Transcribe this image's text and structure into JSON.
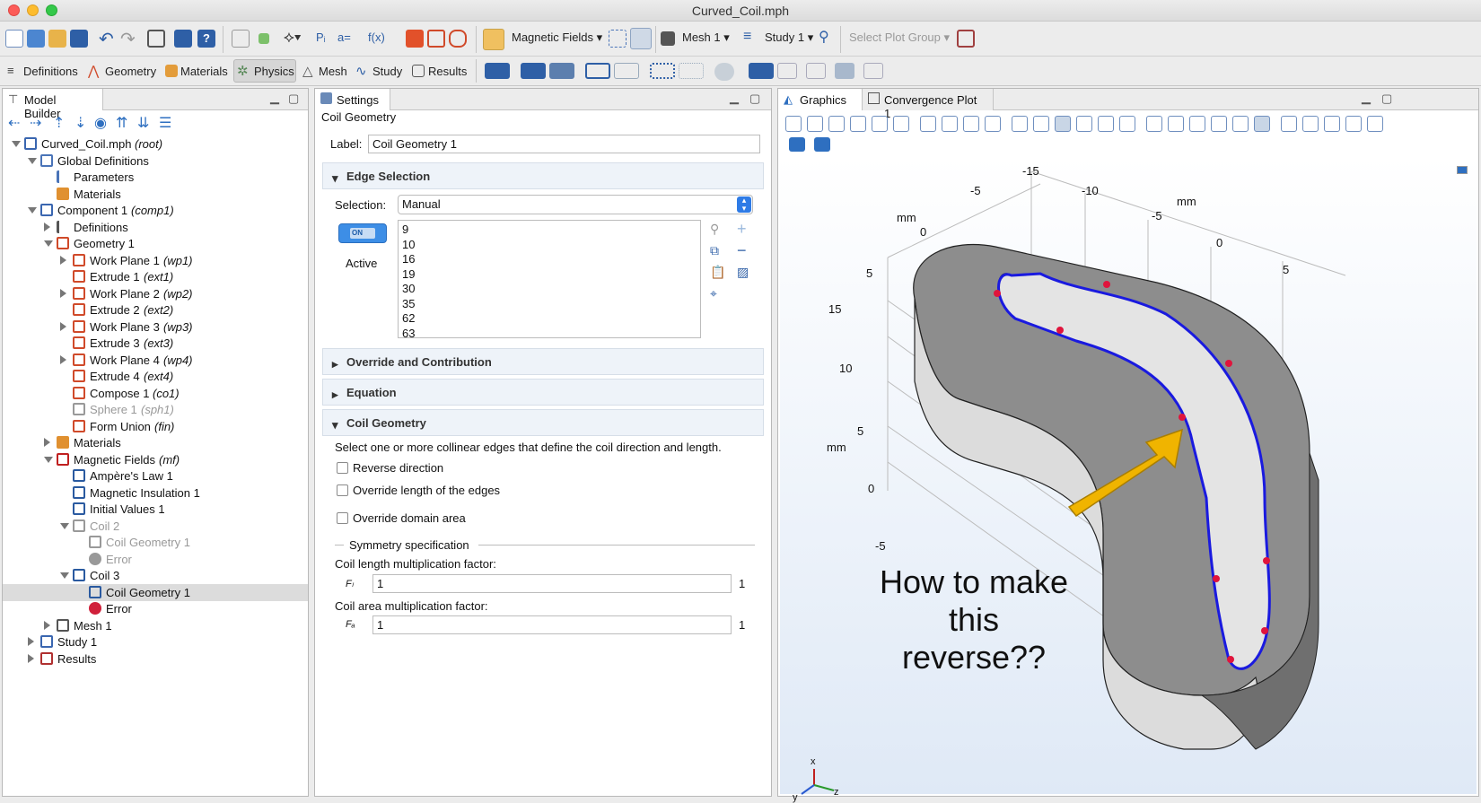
{
  "window": {
    "title": "Curved_Coil.mph"
  },
  "toolbar1": {
    "physics_select": "Magnetic Fields",
    "mesh_select": "Mesh 1",
    "study_select": "Study 1",
    "plot_group_select": "Select Plot Group",
    "param_label": "Pᵢ",
    "assign_label": "a=",
    "func_label": "f(x)"
  },
  "toolbar2": {
    "tabs": [
      "Definitions",
      "Geometry",
      "Materials",
      "Physics",
      "Mesh",
      "Study",
      "Results"
    ],
    "active_tab": "Physics"
  },
  "model_builder": {
    "title": "Model Builder",
    "tree": [
      {
        "label": "Curved_Coil.mph",
        "tag": "(root)",
        "level": 0,
        "expand": "open",
        "icon": "file-icon",
        "color": "#3a66b0"
      },
      {
        "label": "Global Definitions",
        "tag": "",
        "level": 1,
        "expand": "open",
        "icon": "globe-icon",
        "color": "#4a74b8"
      },
      {
        "label": "Parameters",
        "tag": "",
        "level": 2,
        "expand": "none",
        "icon": "parameters-icon",
        "color": "#4a74b8"
      },
      {
        "label": "Materials",
        "tag": "",
        "level": 2,
        "expand": "none",
        "icon": "materials-icon",
        "color": "#e09030"
      },
      {
        "label": "Component 1",
        "tag": "(comp1)",
        "level": 1,
        "expand": "open",
        "icon": "component-icon",
        "color": "#3a66b0"
      },
      {
        "label": "Definitions",
        "tag": "",
        "level": 2,
        "expand": "closed",
        "icon": "definitions-icon",
        "color": "#555"
      },
      {
        "label": "Geometry 1",
        "tag": "",
        "level": 2,
        "expand": "open",
        "icon": "geometry-icon",
        "color": "#d04a2a"
      },
      {
        "label": "Work Plane 1",
        "tag": "(wp1)",
        "level": 3,
        "expand": "closed",
        "icon": "workplane-icon",
        "color": "#d04a2a"
      },
      {
        "label": "Extrude 1",
        "tag": "(ext1)",
        "level": 3,
        "expand": "none",
        "icon": "extrude-icon",
        "color": "#d04a2a"
      },
      {
        "label": "Work Plane 2",
        "tag": "(wp2)",
        "level": 3,
        "expand": "closed",
        "icon": "workplane-icon",
        "color": "#d04a2a"
      },
      {
        "label": "Extrude 2",
        "tag": "(ext2)",
        "level": 3,
        "expand": "none",
        "icon": "extrude-icon",
        "color": "#d04a2a"
      },
      {
        "label": "Work Plane 3",
        "tag": "(wp3)",
        "level": 3,
        "expand": "closed",
        "icon": "workplane-icon",
        "color": "#d04a2a"
      },
      {
        "label": "Extrude 3",
        "tag": "(ext3)",
        "level": 3,
        "expand": "none",
        "icon": "extrude-icon",
        "color": "#d04a2a"
      },
      {
        "label": "Work Plane 4",
        "tag": "(wp4)",
        "level": 3,
        "expand": "closed",
        "icon": "workplane-icon",
        "color": "#d04a2a"
      },
      {
        "label": "Extrude 4",
        "tag": "(ext4)",
        "level": 3,
        "expand": "none",
        "icon": "extrude-icon",
        "color": "#d04a2a"
      },
      {
        "label": "Compose 1",
        "tag": "(co1)",
        "level": 3,
        "expand": "none",
        "icon": "compose-icon",
        "color": "#d04a2a"
      },
      {
        "label": "Sphere 1",
        "tag": "(sph1)",
        "level": 3,
        "expand": "none",
        "icon": "sphere-icon",
        "color": "#999",
        "disabled": true
      },
      {
        "label": "Form Union",
        "tag": "(fin)",
        "level": 3,
        "expand": "none",
        "icon": "form-union-icon",
        "color": "#d04a2a"
      },
      {
        "label": "Materials",
        "tag": "",
        "level": 2,
        "expand": "closed",
        "icon": "materials-icon",
        "color": "#e09030"
      },
      {
        "label": "Magnetic Fields",
        "tag": "(mf)",
        "level": 2,
        "expand": "open",
        "icon": "magnet-icon",
        "color": "#c02020"
      },
      {
        "label": "Ampère's Law 1",
        "tag": "",
        "level": 3,
        "expand": "none",
        "icon": "domain-icon",
        "color": "#2a5aa0"
      },
      {
        "label": "Magnetic Insulation 1",
        "tag": "",
        "level": 3,
        "expand": "none",
        "icon": "boundary-icon",
        "color": "#2a5aa0"
      },
      {
        "label": "Initial Values 1",
        "tag": "",
        "level": 3,
        "expand": "none",
        "icon": "domain-icon",
        "color": "#2a5aa0"
      },
      {
        "label": "Coil 2",
        "tag": "",
        "level": 3,
        "expand": "open",
        "icon": "coil-icon",
        "color": "#999",
        "disabled": true
      },
      {
        "label": "Coil Geometry 1",
        "tag": "",
        "level": 4,
        "expand": "none",
        "icon": "coil-geometry-icon",
        "color": "#999",
        "disabled": true
      },
      {
        "label": "Error",
        "tag": "",
        "level": 4,
        "expand": "none",
        "icon": "error-icon",
        "color": "#999",
        "disabled": true
      },
      {
        "label": "Coil 3",
        "tag": "",
        "level": 3,
        "expand": "open",
        "icon": "coil-icon",
        "color": "#2a5aa0"
      },
      {
        "label": "Coil Geometry 1",
        "tag": "",
        "level": 4,
        "expand": "none",
        "icon": "coil-geometry-icon",
        "color": "#2a5aa0",
        "selected": true
      },
      {
        "label": "Error",
        "tag": "",
        "level": 4,
        "expand": "none",
        "icon": "error-icon",
        "color": "#d0203a"
      },
      {
        "label": "Mesh 1",
        "tag": "",
        "level": 2,
        "expand": "closed",
        "icon": "mesh-icon",
        "color": "#555"
      },
      {
        "label": "Study 1",
        "tag": "",
        "level": 1,
        "expand": "closed",
        "icon": "study-icon",
        "color": "#3a66b0"
      },
      {
        "label": "Results",
        "tag": "",
        "level": 1,
        "expand": "closed",
        "icon": "results-icon",
        "color": "#b03030"
      }
    ]
  },
  "settings": {
    "tab": "Settings",
    "heading": "Coil Geometry",
    "label_caption": "Label:",
    "label_value": "Coil Geometry 1",
    "edge_section": "Edge Selection",
    "selection_caption": "Selection:",
    "selection_value": "Manual",
    "toggle_text": "ON",
    "active_caption": "Active",
    "edges": [
      "9",
      "10",
      "16",
      "19",
      "30",
      "35",
      "62",
      "63"
    ],
    "override_section": "Override and Contribution",
    "equation_section": "Equation",
    "coil_section": "Coil Geometry",
    "coil_description": "Select one or more collinear edges that define the coil direction and length.",
    "reverse_direction": "Reverse direction",
    "override_length": "Override length of the edges",
    "override_domain": "Override domain area",
    "symmetry_caption": "Symmetry specification",
    "length_factor_caption": "Coil length multiplication factor:",
    "length_factor_symbol": "Fₗ",
    "length_factor_value": "1",
    "length_factor_unit": "1",
    "area_factor_caption": "Coil area multiplication factor:",
    "area_factor_symbol": "Fₐ",
    "area_factor_value": "1",
    "area_factor_unit": "1"
  },
  "graphics": {
    "tabs": [
      "Graphics",
      "Convergence Plot 1"
    ],
    "axis_labels": {
      "top": [
        "-15",
        "-5",
        "-10",
        "mm",
        "-5",
        "0",
        "5"
      ],
      "left": [
        "mm",
        "0",
        "5",
        "15",
        "10",
        "5",
        "mm",
        "0",
        "-5"
      ]
    },
    "annotation": [
      "How to make",
      "this",
      "reverse??"
    ],
    "triad": {
      "x": "x",
      "y": "y",
      "z": "z"
    }
  },
  "colors": {
    "accent": "#2e6fc0",
    "selected_row": "#dcdcdc",
    "edge": "#1a1adf",
    "point": "#e0143c",
    "arrow": "#f0b400"
  }
}
